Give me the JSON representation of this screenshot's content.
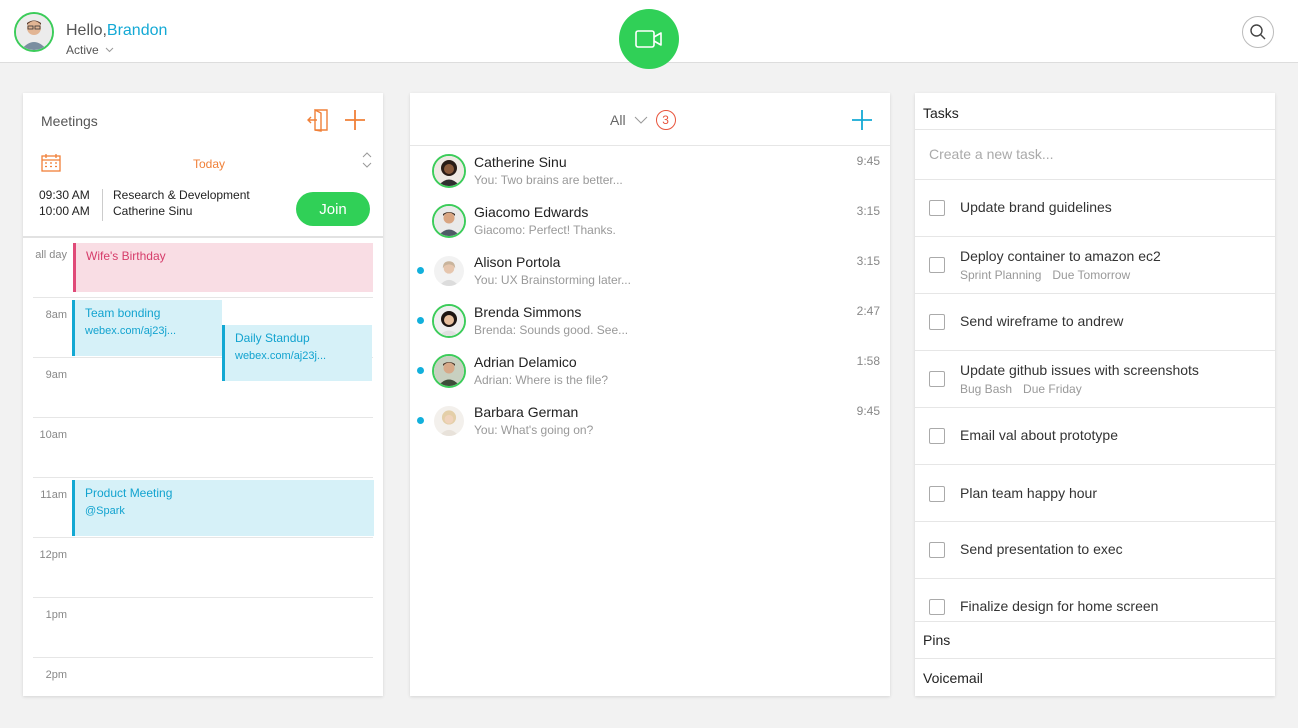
{
  "header": {
    "greeting": "Hello,",
    "user_name": "Brandon",
    "status": "Active",
    "colors": {
      "accent": "#14a9d5",
      "call_green": "#30d057"
    }
  },
  "meetings": {
    "title": "Meetings",
    "today_label": "Today",
    "next_meeting": {
      "start": "09:30 AM",
      "end": "10:00 AM",
      "title": "Research & Development",
      "host": "Catherine Sinu",
      "join_label": "Join"
    },
    "hours": [
      "all day",
      "8am",
      "9am",
      "10am",
      "11am",
      "12pm",
      "1pm",
      "2pm"
    ],
    "events": [
      {
        "title": "Wife's Birthday",
        "subtitle": "",
        "color": "#e04a78"
      },
      {
        "title": "Team bonding",
        "subtitle": "webex.com/aj23j...",
        "color": "#12a8d3"
      },
      {
        "title": "Daily Standup",
        "subtitle": "webex.com/aj23j...",
        "color": "#12a8d3"
      },
      {
        "title": "Product Meeting",
        "subtitle": "@Spark",
        "color": "#12a8d3"
      }
    ]
  },
  "messages": {
    "filter_label": "All",
    "unread_count": "3",
    "items": [
      {
        "name": "Catherine Sinu",
        "preview": "You: Two brains are better...",
        "time": "9:45",
        "unread": false
      },
      {
        "name": "Giacomo Edwards",
        "preview": "Giacomo: Perfect! Thanks.",
        "time": "3:15",
        "unread": false
      },
      {
        "name": "Alison Portola",
        "preview": "You: UX Brainstorming later...",
        "time": "3:15",
        "unread": true
      },
      {
        "name": "Brenda Simmons",
        "preview": "Brenda: Sounds good. See...",
        "time": "2:47",
        "unread": true
      },
      {
        "name": "Adrian Delamico",
        "preview": "Adrian: Where is the file?",
        "time": "1:58",
        "unread": true
      },
      {
        "name": "Barbara German",
        "preview": "You: What's going on?",
        "time": "9:45",
        "unread": true
      }
    ]
  },
  "tasks": {
    "title": "Tasks",
    "new_task_placeholder": "Create a new task...",
    "items": [
      {
        "label": "Update brand guidelines",
        "meta": []
      },
      {
        "label": "Deploy container to amazon ec2",
        "meta": [
          "Sprint Planning",
          "Due Tomorrow"
        ]
      },
      {
        "label": "Send wireframe to andrew",
        "meta": []
      },
      {
        "label": "Update github issues with screenshots",
        "meta": [
          "Bug Bash",
          "Due Friday"
        ]
      },
      {
        "label": "Email val about prototype",
        "meta": []
      },
      {
        "label": "Plan team happy hour",
        "meta": []
      },
      {
        "label": "Send presentation to exec",
        "meta": []
      },
      {
        "label": "Finalize design for home screen",
        "meta": []
      }
    ],
    "pins_label": "Pins",
    "voicemail_label": "Voicemail"
  }
}
